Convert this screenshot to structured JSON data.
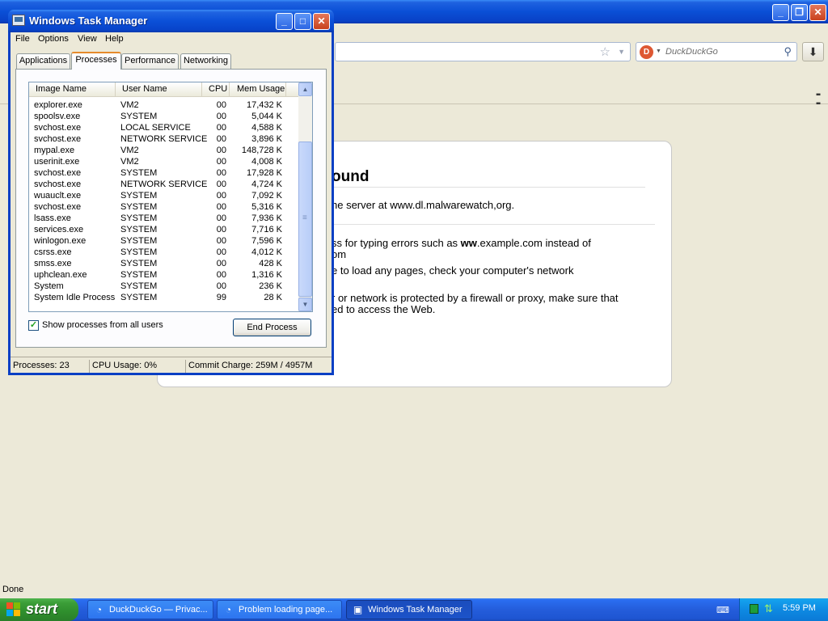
{
  "browser": {
    "search_placeholder": "DuckDuckGo",
    "status": "Done",
    "error": {
      "title": "ound",
      "description": "he server at www.dl.malwarewatch,org.",
      "items": [
        [
          "ss for typing errors such as ",
          "ww",
          ".example.com instead of"
        ],
        [
          "om"
        ],
        [
          "e to load any pages, check your computer's network"
        ],
        [
          "r or network is protected by a firewall or proxy, make sure that"
        ],
        [
          "ed to access the Web."
        ]
      ]
    }
  },
  "taskmgr": {
    "title": "Windows Task Manager",
    "menu": [
      "File",
      "Options",
      "View",
      "Help"
    ],
    "tabs": [
      "Applications",
      "Processes",
      "Performance",
      "Networking"
    ],
    "active_tab": "Processes",
    "columns": [
      "Image Name",
      "User Name",
      "CPU",
      "Mem Usage"
    ],
    "processes": [
      [
        "explorer.exe",
        "VM2",
        "00",
        "17,432 K"
      ],
      [
        "spoolsv.exe",
        "SYSTEM",
        "00",
        "5,044 K"
      ],
      [
        "svchost.exe",
        "LOCAL SERVICE",
        "00",
        "4,588 K"
      ],
      [
        "svchost.exe",
        "NETWORK SERVICE",
        "00",
        "3,896 K"
      ],
      [
        "mypal.exe",
        "VM2",
        "00",
        "148,728 K"
      ],
      [
        "userinit.exe",
        "VM2",
        "00",
        "4,008 K"
      ],
      [
        "svchost.exe",
        "SYSTEM",
        "00",
        "17,928 K"
      ],
      [
        "svchost.exe",
        "NETWORK SERVICE",
        "00",
        "4,724 K"
      ],
      [
        "wuauclt.exe",
        "SYSTEM",
        "00",
        "7,092 K"
      ],
      [
        "svchost.exe",
        "SYSTEM",
        "00",
        "5,316 K"
      ],
      [
        "lsass.exe",
        "SYSTEM",
        "00",
        "7,936 K"
      ],
      [
        "services.exe",
        "SYSTEM",
        "00",
        "7,716 K"
      ],
      [
        "winlogon.exe",
        "SYSTEM",
        "00",
        "7,596 K"
      ],
      [
        "csrss.exe",
        "SYSTEM",
        "00",
        "4,012 K"
      ],
      [
        "smss.exe",
        "SYSTEM",
        "00",
        "428 K"
      ],
      [
        "uphclean.exe",
        "SYSTEM",
        "00",
        "1,316 K"
      ],
      [
        "System",
        "SYSTEM",
        "00",
        "236 K"
      ],
      [
        "System Idle Process",
        "SYSTEM",
        "99",
        "28 K"
      ]
    ],
    "show_all_label": "Show processes from all users",
    "show_all_checked": true,
    "end_process_label": "End Process",
    "status": {
      "processes": "Processes: 23",
      "cpu": "CPU Usage: 0%",
      "commit": "Commit Charge: 259M / 4957M"
    }
  },
  "taskbar": {
    "start_label": "start",
    "items": [
      {
        "label": "DuckDuckGo — Privac...",
        "active": false
      },
      {
        "label": "Problem loading page...",
        "active": false
      },
      {
        "label": "Windows Task Manager",
        "active": true
      }
    ],
    "clock": "5:59 PM"
  },
  "colors": {
    "xp_blue": "#0a4fd6",
    "start_green": "#3b9e38",
    "tab_highlight": "#e68b2c",
    "tray_blue": "#0e8ae2"
  }
}
